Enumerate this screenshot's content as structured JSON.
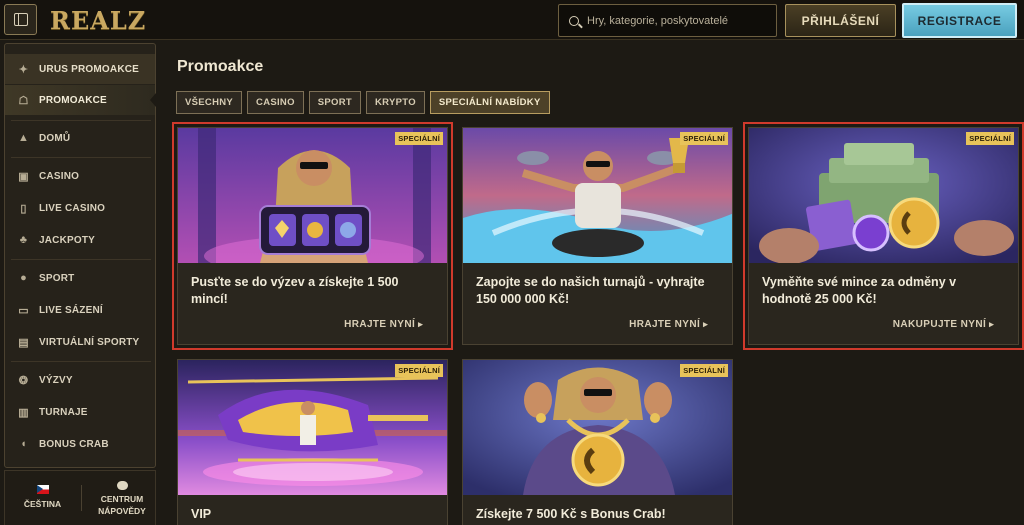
{
  "header": {
    "logo": "REALZ",
    "search_placeholder": "Hry, kategorie, poskytovatelé",
    "login_label": "PŘIHLÁŠENÍ",
    "register_label": "REGISTRACE",
    "colors": {
      "register": "#5bb3cf",
      "accent": "#c9a861"
    }
  },
  "sidebar": {
    "items": [
      {
        "label": "URUS PROMOAKCE",
        "icon": "car-icon"
      },
      {
        "label": "PROMOAKCE",
        "icon": "gift-icon"
      },
      {
        "label": "DOMŮ",
        "icon": "pyramid-icon"
      },
      {
        "label": "CASINO",
        "icon": "slot-machine-icon"
      },
      {
        "label": "LIVE CASINO",
        "icon": "cards-icon"
      },
      {
        "label": "JACKPOTY",
        "icon": "clover-icon"
      },
      {
        "label": "SPORT",
        "icon": "ball-icon"
      },
      {
        "label": "LIVE SÁZENÍ",
        "icon": "live-icon"
      },
      {
        "label": "VIRTUÁLNÍ SPORTY",
        "icon": "virtual-icon"
      },
      {
        "label": "VÝZVY",
        "icon": "medal-icon"
      },
      {
        "label": "TURNAJE",
        "icon": "tournament-icon"
      },
      {
        "label": "BONUS CRAB",
        "icon": "crab-icon"
      }
    ],
    "footer": {
      "language": "ČEŠTINA",
      "help_line1": "CENTRUM",
      "help_line2": "NÁPOVĚDY"
    }
  },
  "main": {
    "title": "Promoakce",
    "filters": [
      "VŠECHNY",
      "CASINO",
      "SPORT",
      "KRYPTO",
      "SPECIÁLNÍ NABÍDKY"
    ],
    "active_filter": "SPECIÁLNÍ NABÍDKY",
    "cards": [
      {
        "badge": "SPECIÁLNÍ",
        "title": "Pusťte se do výzev a získejte 1 500 mincí!",
        "cta": "HRAJTE NYNÍ"
      },
      {
        "badge": "SPECIÁLNÍ",
        "title": "Zapojte se do našich turnajů - vyhrajte 150 000 000 Kč!",
        "cta": "HRAJTE NYNÍ"
      },
      {
        "badge": "SPECIÁLNÍ",
        "title": "Vyměňte své mince za odměny v hodnotě 25 000 Kč!",
        "cta": "NAKUPUJTE NYNÍ"
      },
      {
        "badge": "SPECIÁLNÍ",
        "title": "VIP",
        "cta": ""
      },
      {
        "badge": "SPECIÁLNÍ",
        "title": "Získejte 7 500 Kč s Bonus Crab!",
        "cta": ""
      }
    ]
  }
}
